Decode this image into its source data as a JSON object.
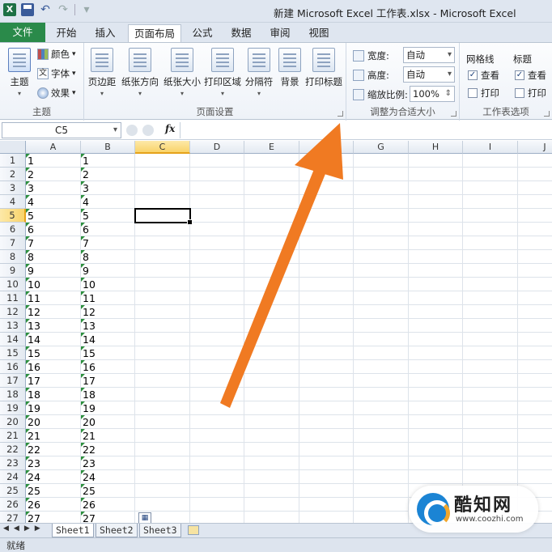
{
  "window": {
    "title": "新建 Microsoft Excel 工作表.xlsx  -  Microsoft Excel"
  },
  "tabs": [
    "文件",
    "开始",
    "插入",
    "页面布局",
    "公式",
    "数据",
    "审阅",
    "视图"
  ],
  "active_tab": "页面布局",
  "ribbon": {
    "theme_group": {
      "label": "主题",
      "theme_button": "主题",
      "colors": "颜色",
      "fonts": "字体",
      "effects": "效果"
    },
    "page_setup_group": {
      "label": "页面设置",
      "buttons": [
        "页边距",
        "纸张方向",
        "纸张大小",
        "打印区域",
        "分隔符",
        "背景",
        "打印标题"
      ]
    },
    "scale_group": {
      "label": "调整为合适大小",
      "width_label": "宽度:",
      "width_value": "自动",
      "height_label": "高度:",
      "height_value": "自动",
      "scale_label": "缩放比例:",
      "scale_value": "100%"
    },
    "sheet_options_group": {
      "label": "工作表选项",
      "gridlines": {
        "title": "网格线",
        "view": "查看",
        "print": "打印",
        "view_checked": true,
        "print_checked": false
      },
      "headings": {
        "title": "标题",
        "view": "查看",
        "print": "打印",
        "view_checked": true,
        "print_checked": false
      }
    }
  },
  "formula_bar": {
    "name_box": "C5",
    "fx_label": "fx",
    "formula": ""
  },
  "sheet": {
    "columns": [
      "A",
      "B",
      "C",
      "D",
      "E",
      "F",
      "G",
      "H",
      "I",
      "J"
    ],
    "selected_column": "C",
    "selected_row": 5,
    "rows": [
      "1",
      "2",
      "3",
      "4",
      "5",
      "6",
      "7",
      "8",
      "9",
      "10",
      "11",
      "12",
      "13",
      "14",
      "15",
      "16",
      "17",
      "18",
      "19",
      "20",
      "21",
      "22",
      "23",
      "24",
      "25",
      "26",
      "27"
    ],
    "col_a": [
      "1",
      "2",
      "3",
      "4",
      "5",
      "6",
      "7",
      "8",
      "9",
      "10",
      "11",
      "12",
      "13",
      "14",
      "15",
      "16",
      "17",
      "18",
      "19",
      "20",
      "21",
      "22",
      "23",
      "24",
      "25",
      "26",
      "27"
    ],
    "col_b": [
      "1",
      "2",
      "3",
      "4",
      "5",
      "6",
      "7",
      "8",
      "9",
      "10",
      "11",
      "12",
      "13",
      "14",
      "15",
      "16",
      "17",
      "18",
      "19",
      "20",
      "21",
      "22",
      "23",
      "24",
      "25",
      "26",
      "27"
    ]
  },
  "sheet_tabs": [
    "Sheet1",
    "Sheet2",
    "Sheet3"
  ],
  "active_sheet": "Sheet1",
  "status": "就绪",
  "watermark": {
    "title": "酷知网",
    "url": "www.coozhi.com"
  },
  "colors": {
    "file_tab": "#2a8a4a",
    "arrow": "#f07a22",
    "accent": "#1b84d4"
  }
}
